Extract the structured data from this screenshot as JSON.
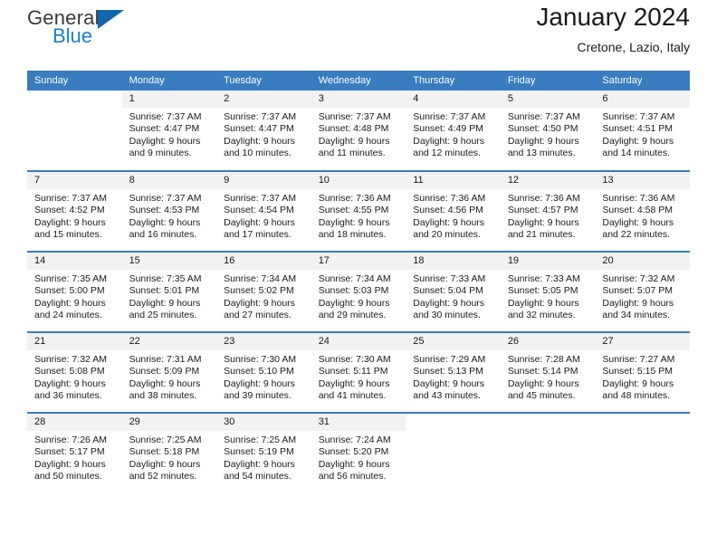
{
  "brand": {
    "name_top": "General",
    "name_bottom": "Blue",
    "color_dark": "#3b3b3b",
    "color_blue": "#1b7fd4",
    "triangle_color": "#1266b0"
  },
  "header": {
    "title": "January 2024",
    "subtitle": "Cretone, Lazio, Italy"
  },
  "theme": {
    "header_bg": "#3a7cc0",
    "daynum_bg": "#f2f2f2",
    "text": "#1a1a1a"
  },
  "calendar": {
    "day_names": [
      "Sunday",
      "Monday",
      "Tuesday",
      "Wednesday",
      "Thursday",
      "Friday",
      "Saturday"
    ],
    "weeks": [
      [
        {
          "day": "",
          "lines": []
        },
        {
          "day": "1",
          "lines": [
            "Sunrise: 7:37 AM",
            "Sunset: 4:47 PM",
            "Daylight: 9 hours",
            "and 9 minutes."
          ]
        },
        {
          "day": "2",
          "lines": [
            "Sunrise: 7:37 AM",
            "Sunset: 4:47 PM",
            "Daylight: 9 hours",
            "and 10 minutes."
          ]
        },
        {
          "day": "3",
          "lines": [
            "Sunrise: 7:37 AM",
            "Sunset: 4:48 PM",
            "Daylight: 9 hours",
            "and 11 minutes."
          ]
        },
        {
          "day": "4",
          "lines": [
            "Sunrise: 7:37 AM",
            "Sunset: 4:49 PM",
            "Daylight: 9 hours",
            "and 12 minutes."
          ]
        },
        {
          "day": "5",
          "lines": [
            "Sunrise: 7:37 AM",
            "Sunset: 4:50 PM",
            "Daylight: 9 hours",
            "and 13 minutes."
          ]
        },
        {
          "day": "6",
          "lines": [
            "Sunrise: 7:37 AM",
            "Sunset: 4:51 PM",
            "Daylight: 9 hours",
            "and 14 minutes."
          ]
        }
      ],
      [
        {
          "day": "7",
          "lines": [
            "Sunrise: 7:37 AM",
            "Sunset: 4:52 PM",
            "Daylight: 9 hours",
            "and 15 minutes."
          ]
        },
        {
          "day": "8",
          "lines": [
            "Sunrise: 7:37 AM",
            "Sunset: 4:53 PM",
            "Daylight: 9 hours",
            "and 16 minutes."
          ]
        },
        {
          "day": "9",
          "lines": [
            "Sunrise: 7:37 AM",
            "Sunset: 4:54 PM",
            "Daylight: 9 hours",
            "and 17 minutes."
          ]
        },
        {
          "day": "10",
          "lines": [
            "Sunrise: 7:36 AM",
            "Sunset: 4:55 PM",
            "Daylight: 9 hours",
            "and 18 minutes."
          ]
        },
        {
          "day": "11",
          "lines": [
            "Sunrise: 7:36 AM",
            "Sunset: 4:56 PM",
            "Daylight: 9 hours",
            "and 20 minutes."
          ]
        },
        {
          "day": "12",
          "lines": [
            "Sunrise: 7:36 AM",
            "Sunset: 4:57 PM",
            "Daylight: 9 hours",
            "and 21 minutes."
          ]
        },
        {
          "day": "13",
          "lines": [
            "Sunrise: 7:36 AM",
            "Sunset: 4:58 PM",
            "Daylight: 9 hours",
            "and 22 minutes."
          ]
        }
      ],
      [
        {
          "day": "14",
          "lines": [
            "Sunrise: 7:35 AM",
            "Sunset: 5:00 PM",
            "Daylight: 9 hours",
            "and 24 minutes."
          ]
        },
        {
          "day": "15",
          "lines": [
            "Sunrise: 7:35 AM",
            "Sunset: 5:01 PM",
            "Daylight: 9 hours",
            "and 25 minutes."
          ]
        },
        {
          "day": "16",
          "lines": [
            "Sunrise: 7:34 AM",
            "Sunset: 5:02 PM",
            "Daylight: 9 hours",
            "and 27 minutes."
          ]
        },
        {
          "day": "17",
          "lines": [
            "Sunrise: 7:34 AM",
            "Sunset: 5:03 PM",
            "Daylight: 9 hours",
            "and 29 minutes."
          ]
        },
        {
          "day": "18",
          "lines": [
            "Sunrise: 7:33 AM",
            "Sunset: 5:04 PM",
            "Daylight: 9 hours",
            "and 30 minutes."
          ]
        },
        {
          "day": "19",
          "lines": [
            "Sunrise: 7:33 AM",
            "Sunset: 5:05 PM",
            "Daylight: 9 hours",
            "and 32 minutes."
          ]
        },
        {
          "day": "20",
          "lines": [
            "Sunrise: 7:32 AM",
            "Sunset: 5:07 PM",
            "Daylight: 9 hours",
            "and 34 minutes."
          ]
        }
      ],
      [
        {
          "day": "21",
          "lines": [
            "Sunrise: 7:32 AM",
            "Sunset: 5:08 PM",
            "Daylight: 9 hours",
            "and 36 minutes."
          ]
        },
        {
          "day": "22",
          "lines": [
            "Sunrise: 7:31 AM",
            "Sunset: 5:09 PM",
            "Daylight: 9 hours",
            "and 38 minutes."
          ]
        },
        {
          "day": "23",
          "lines": [
            "Sunrise: 7:30 AM",
            "Sunset: 5:10 PM",
            "Daylight: 9 hours",
            "and 39 minutes."
          ]
        },
        {
          "day": "24",
          "lines": [
            "Sunrise: 7:30 AM",
            "Sunset: 5:11 PM",
            "Daylight: 9 hours",
            "and 41 minutes."
          ]
        },
        {
          "day": "25",
          "lines": [
            "Sunrise: 7:29 AM",
            "Sunset: 5:13 PM",
            "Daylight: 9 hours",
            "and 43 minutes."
          ]
        },
        {
          "day": "26",
          "lines": [
            "Sunrise: 7:28 AM",
            "Sunset: 5:14 PM",
            "Daylight: 9 hours",
            "and 45 minutes."
          ]
        },
        {
          "day": "27",
          "lines": [
            "Sunrise: 7:27 AM",
            "Sunset: 5:15 PM",
            "Daylight: 9 hours",
            "and 48 minutes."
          ]
        }
      ],
      [
        {
          "day": "28",
          "lines": [
            "Sunrise: 7:26 AM",
            "Sunset: 5:17 PM",
            "Daylight: 9 hours",
            "and 50 minutes."
          ]
        },
        {
          "day": "29",
          "lines": [
            "Sunrise: 7:25 AM",
            "Sunset: 5:18 PM",
            "Daylight: 9 hours",
            "and 52 minutes."
          ]
        },
        {
          "day": "30",
          "lines": [
            "Sunrise: 7:25 AM",
            "Sunset: 5:19 PM",
            "Daylight: 9 hours",
            "and 54 minutes."
          ]
        },
        {
          "day": "31",
          "lines": [
            "Sunrise: 7:24 AM",
            "Sunset: 5:20 PM",
            "Daylight: 9 hours",
            "and 56 minutes."
          ]
        },
        {
          "day": "",
          "lines": []
        },
        {
          "day": "",
          "lines": []
        },
        {
          "day": "",
          "lines": []
        }
      ]
    ]
  }
}
